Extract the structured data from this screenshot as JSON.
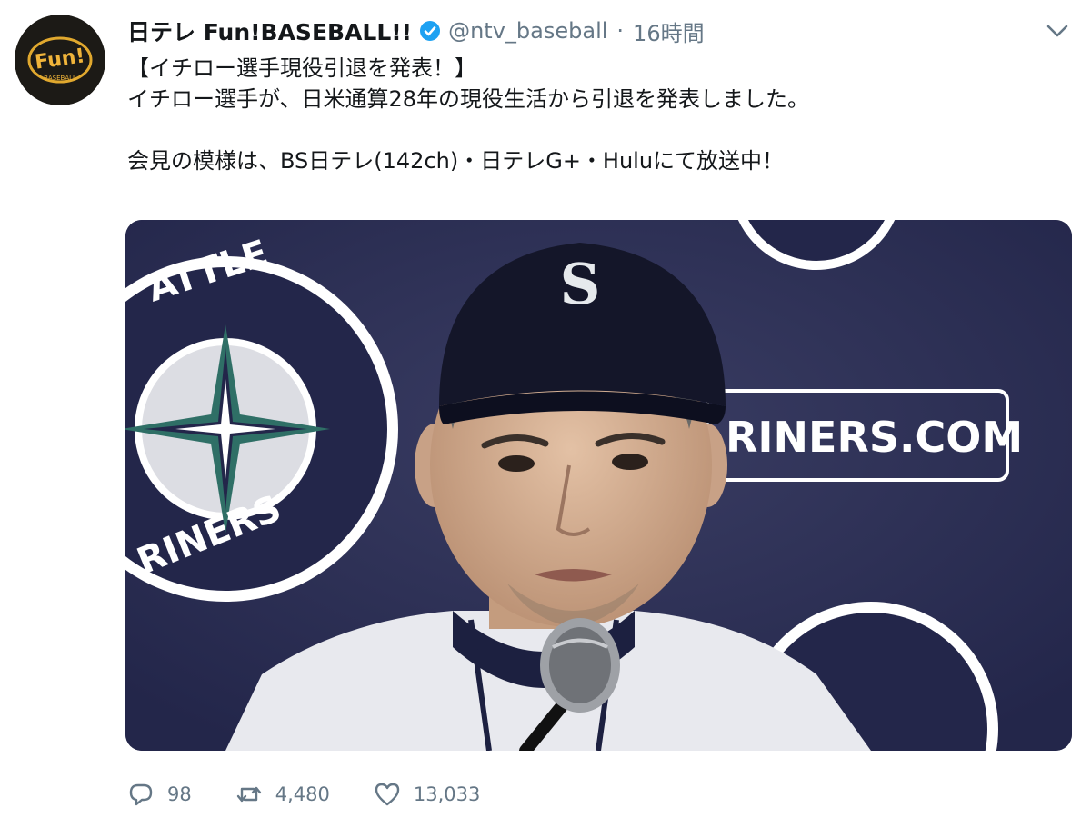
{
  "account": {
    "display_name": "日テレ Fun!BASEBALL!!",
    "handle": "@ntv_baseball",
    "separator": "·",
    "time": "16時間",
    "avatar_text": "Fun!",
    "avatar_subtext": "BASEBALL"
  },
  "tweet": {
    "lines": [
      "【イチロー選手現役引退を発表！】",
      "イチロー選手が、日米通算28年の現役生活から引退を発表しました。",
      "会見の模様は、BS日テレ(142ch)・日テレG+・Huluにて放送中！"
    ]
  },
  "media": {
    "backdrop_top_text": "ATTLE",
    "backdrop_bottom_text": "RINERS",
    "backdrop_url_text": "RINERS.COM",
    "cap_logo_text": "S"
  },
  "actions": {
    "reply_count": "98",
    "retweet_count": "4,480",
    "like_count": "13,033"
  },
  "colors": {
    "verified": "#1da1f2",
    "muted": "#657786",
    "backdrop": "#2a2d4e",
    "mariners_teal": "#2f6f66"
  },
  "icons": {
    "verified": "verified-badge-icon",
    "caret": "chevron-down-icon",
    "reply": "reply-icon",
    "retweet": "retweet-icon",
    "like": "heart-icon"
  }
}
